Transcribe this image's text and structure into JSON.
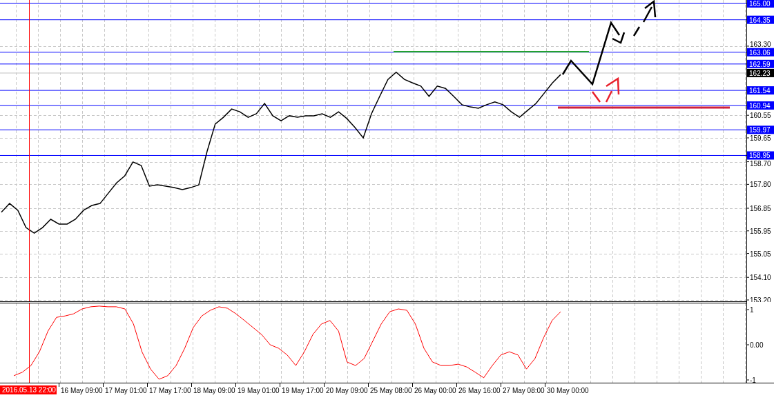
{
  "price_chart": {
    "chart_data": {
      "type": "line",
      "ylim": [
        153.2,
        165.0
      ],
      "series": [
        {
          "color": "#000000",
          "values": [
            156.69,
            157.04,
            156.77,
            156.08,
            155.86,
            156.08,
            156.41,
            156.22,
            156.22,
            156.41,
            156.77,
            156.96,
            157.04,
            157.45,
            157.86,
            158.14,
            158.69,
            158.55,
            157.73,
            157.78,
            157.73,
            157.67,
            157.59,
            157.67,
            157.78,
            159.1,
            160.2,
            160.47,
            160.8,
            160.69,
            160.47,
            160.61,
            161.02,
            160.53,
            160.33,
            160.53,
            160.47,
            160.53,
            160.53,
            160.61,
            160.47,
            160.69,
            160.42,
            160.06,
            159.65,
            160.61,
            161.3,
            161.98,
            162.26,
            161.98,
            161.84,
            161.71,
            161.3,
            161.71,
            161.62,
            161.3,
            160.97,
            160.88,
            160.83,
            160.97,
            161.08,
            160.97,
            160.69,
            160.47,
            160.75,
            161.02,
            161.43,
            161.84,
            162.17
          ]
        }
      ],
      "yticks": [
        {
          "value": 163.3,
          "label": "163.30"
        },
        {
          "value": 160.55,
          "label": "160.55"
        },
        {
          "value": 159.65,
          "label": "159.65"
        },
        {
          "value": 158.7,
          "label": "158.70"
        },
        {
          "value": 157.8,
          "label": "157.80"
        },
        {
          "value": 156.85,
          "label": "156.85"
        },
        {
          "value": 155.95,
          "label": "155.95"
        },
        {
          "value": 155.05,
          "label": "155.05"
        },
        {
          "value": 154.1,
          "label": "154.10"
        },
        {
          "value": 153.2,
          "label": "153.20"
        }
      ],
      "ref_lines": [
        {
          "axis": "y",
          "value": 165.0,
          "label": "165.00",
          "color": "#0000ff"
        },
        {
          "axis": "y",
          "value": 164.35,
          "label": "164.35",
          "color": "#0000ff"
        },
        {
          "axis": "y",
          "value": 163.06,
          "label": "163.06",
          "color": "#0000ff"
        },
        {
          "axis": "y",
          "value": 162.59,
          "label": "162.59",
          "color": "#0000ff"
        },
        {
          "axis": "y",
          "value": 162.23,
          "label": "162.23",
          "color": "#c0c0c0"
        },
        {
          "axis": "y",
          "value": 161.54,
          "label": "161.54",
          "color": "#0000ff"
        },
        {
          "axis": "y",
          "value": 160.94,
          "label": "160.94",
          "color": "#0000ff"
        },
        {
          "axis": "y",
          "value": 159.97,
          "label": "159.97",
          "color": "#0000ff"
        },
        {
          "axis": "y",
          "value": 158.95,
          "label": "158.95",
          "color": "#0000ff"
        }
      ],
      "grid": true
    }
  },
  "oscillator": {
    "chart_data": {
      "type": "line",
      "ylim": [
        -1.1,
        1.15
      ],
      "grid": true,
      "categories": [
        null,
        null,
        null,
        null,
        null,
        null,
        null,
        null,
        null,
        null,
        null,
        null,
        null,
        null,
        null,
        null,
        null,
        null,
        null,
        null,
        null,
        null,
        null,
        null,
        null,
        null,
        null,
        null,
        null,
        null,
        null,
        null,
        null,
        null,
        null,
        null,
        null,
        null,
        null,
        null,
        null,
        null,
        null,
        null,
        null,
        null,
        null,
        null,
        null,
        null,
        null,
        null,
        null,
        null,
        null,
        null,
        null,
        null,
        null,
        null,
        null,
        null,
        null,
        null,
        null
      ],
      "series": [
        {
          "color": "#ff0000",
          "values": [
            -0.88,
            -0.78,
            -0.59,
            -0.2,
            0.39,
            0.78,
            0.82,
            0.88,
            1.02,
            1.08,
            1.1,
            1.08,
            1.08,
            1.02,
            0.59,
            -0.2,
            -0.69,
            -0.98,
            -0.88,
            -0.59,
            -0.1,
            0.49,
            0.82,
            0.98,
            1.08,
            1.04,
            0.88,
            0.69,
            0.49,
            0.29,
            0,
            -0.1,
            -0.29,
            -0.59,
            -0.2,
            0.29,
            0.59,
            0.69,
            0.39,
            -0.49,
            -0.59,
            -0.39,
            0.1,
            0.59,
            0.94,
            1.02,
            0.98,
            0.59,
            -0.1,
            -0.49,
            -0.59,
            -0.59,
            -0.55,
            -0.63,
            -0.78,
            -0.94,
            -0.59,
            -0.29,
            -0.2,
            -0.29,
            -0.69,
            -0.39,
            0.2,
            0.69,
            0.94
          ]
        }
      ],
      "yticks": [
        {
          "value": 1,
          "label": "1"
        },
        {
          "value": 0,
          "label": "0.00"
        },
        {
          "value": -1,
          "label": "-1"
        }
      ]
    }
  },
  "time_axis": [
    {
      "label": "2016.05.13 22:00",
      "selected": true
    },
    {
      "label": "16 May 09:00",
      "selected": false
    },
    {
      "label": "17 May 01:00",
      "selected": false
    },
    {
      "label": "17 May 17:00",
      "selected": false
    },
    {
      "label": "18 May 09:00",
      "selected": false
    },
    {
      "label": "19 May 01:00",
      "selected": false
    },
    {
      "label": "19 May 17:00",
      "selected": false
    },
    {
      "label": "20 May 09:00",
      "selected": false
    },
    {
      "label": "25 May 08:00",
      "selected": false
    },
    {
      "label": "26 May 00:00",
      "selected": false
    },
    {
      "label": "26 May 16:00",
      "selected": false
    },
    {
      "label": "27 May 08:00",
      "selected": false
    },
    {
      "label": "30 May 00:00",
      "selected": false
    }
  ]
}
